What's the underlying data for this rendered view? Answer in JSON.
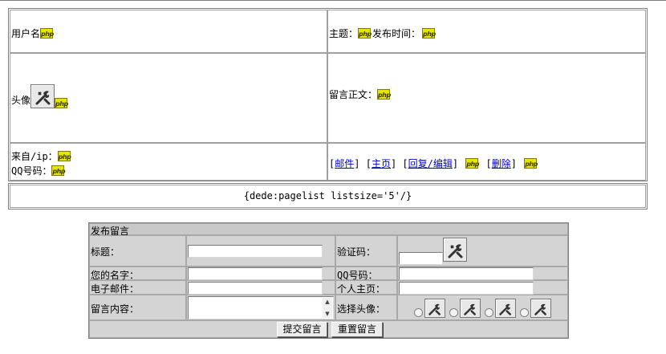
{
  "message": {
    "username_label": "用户名",
    "subject_label": "主题：",
    "time_label": "发布时间：",
    "avatar_label": "头像",
    "body_label": "留言正文：",
    "from_label": "来自/ip：",
    "qq_label": "QQ号码：",
    "links": {
      "email": "邮件",
      "homepage": "主页",
      "reply_edit": "回复/编辑",
      "delete": "删除"
    },
    "php_badge": "php"
  },
  "pager": {
    "text": "{dede:pagelist listsize='5'/}"
  },
  "form": {
    "title": "发布留言",
    "fields": {
      "subject": "标题：",
      "captcha": "验证码：",
      "name": "您的名字：",
      "qq": "QQ号码：",
      "email": "电子邮件：",
      "homepage": "个人主页：",
      "content": "留言内容：",
      "avatar": "选择头像："
    },
    "submit_label": "提交留言",
    "reset_label": "重置留言"
  }
}
